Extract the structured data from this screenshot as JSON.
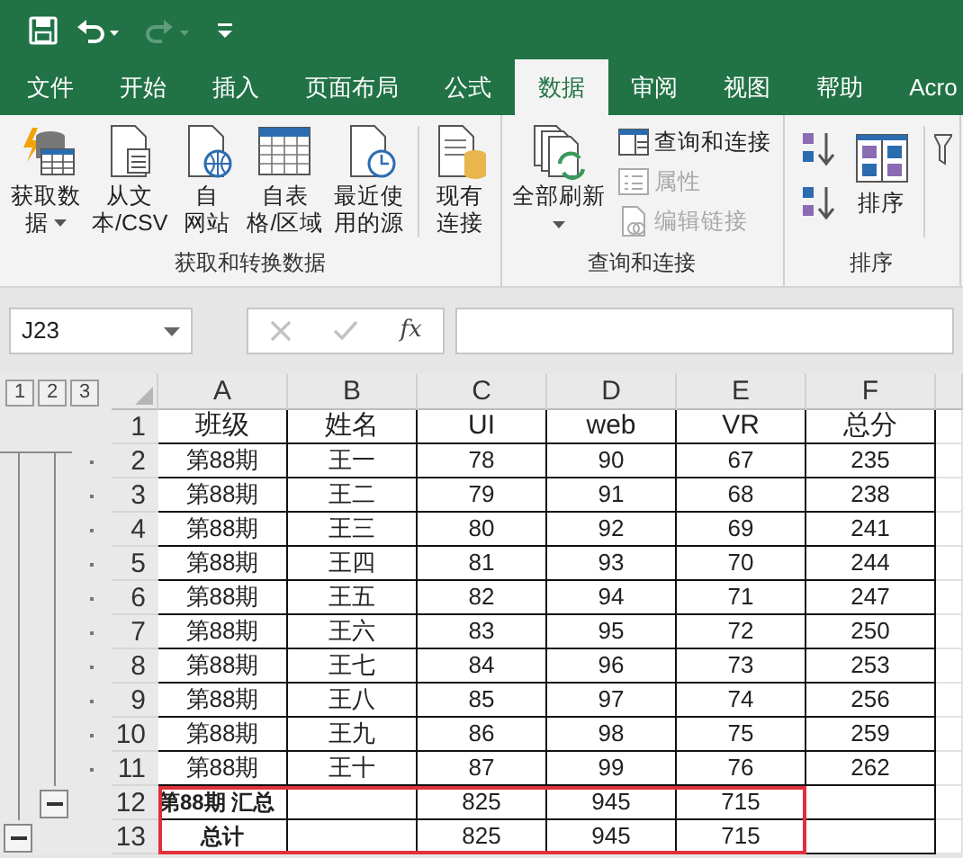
{
  "quick_access": [
    {
      "kind": "save",
      "disabled": false
    },
    {
      "kind": "undo",
      "disabled": false
    },
    {
      "kind": "redo",
      "disabled": true
    },
    {
      "kind": "customize",
      "disabled": false
    }
  ],
  "tabs": [
    {
      "label": "文件",
      "selected": false
    },
    {
      "label": "开始",
      "selected": false
    },
    {
      "label": "插入",
      "selected": false
    },
    {
      "label": "页面布局",
      "selected": false
    },
    {
      "label": "公式",
      "selected": false
    },
    {
      "label": "数据",
      "selected": true
    },
    {
      "label": "审阅",
      "selected": false
    },
    {
      "label": "视图",
      "selected": false
    },
    {
      "label": "帮助",
      "selected": false
    },
    {
      "label": "Acro",
      "selected": false
    }
  ],
  "ribbon_groups": [
    {
      "label": "获取和转换数据",
      "items": [
        {
          "kind": "large",
          "label_lines": [
            "获取数",
            "据"
          ],
          "dropdown": true,
          "disabled": false
        },
        {
          "kind": "large",
          "label_lines": [
            "从文",
            "本/CSV"
          ],
          "dropdown": false,
          "disabled": false
        },
        {
          "kind": "large",
          "label_lines": [
            "自",
            "网站"
          ],
          "dropdown": false,
          "disabled": false
        },
        {
          "kind": "large",
          "label_lines": [
            "自表",
            "格/区域"
          ],
          "dropdown": false,
          "disabled": false
        },
        {
          "kind": "large",
          "label_lines": [
            "最近使",
            "用的源"
          ],
          "dropdown": false,
          "disabled": false
        },
        {
          "kind": "separator"
        },
        {
          "kind": "large",
          "label_lines": [
            "现有",
            "连接"
          ],
          "dropdown": false,
          "disabled": false
        }
      ]
    },
    {
      "label": "查询和连接",
      "items": [
        {
          "kind": "large",
          "label_lines": [
            "全部刷新"
          ],
          "dropdown": true,
          "disabled": false
        },
        {
          "kind": "small_stack",
          "items": [
            {
              "label": "查询和连接",
              "disabled": false
            },
            {
              "label": "属性",
              "disabled": true
            },
            {
              "label": "编辑链接",
              "disabled": true
            }
          ]
        }
      ]
    },
    {
      "label": "排序",
      "items": [
        {
          "kind": "sort_icons"
        },
        {
          "kind": "large",
          "label_lines": [
            "排序"
          ],
          "dropdown": false,
          "disabled": false
        },
        {
          "kind": "separator"
        },
        {
          "kind": "cut_icon"
        }
      ]
    }
  ],
  "name_box": {
    "value": "J23"
  },
  "formula_buttons": [
    {
      "kind": "cancel",
      "disabled": true
    },
    {
      "kind": "enter",
      "disabled": true
    },
    {
      "kind": "function",
      "label": "fx",
      "disabled": false
    }
  ],
  "outline_levels": [
    {
      "label": "1"
    },
    {
      "label": "2"
    },
    {
      "label": "3"
    }
  ],
  "columns": [
    "A",
    "B",
    "C",
    "D",
    "E",
    "F"
  ],
  "rows": [
    {
      "number": "1",
      "kind": "header",
      "highlighted": false,
      "cells": [
        "班级",
        "姓名",
        "UI",
        "web",
        "VR",
        "总分"
      ]
    },
    {
      "number": "2",
      "kind": "detail",
      "highlighted": false,
      "cells": [
        "第88期",
        "王一",
        "78",
        "90",
        "67",
        "235"
      ]
    },
    {
      "number": "3",
      "kind": "detail",
      "highlighted": false,
      "cells": [
        "第88期",
        "王二",
        "79",
        "91",
        "68",
        "238"
      ]
    },
    {
      "number": "4",
      "kind": "detail",
      "highlighted": false,
      "cells": [
        "第88期",
        "王三",
        "80",
        "92",
        "69",
        "241"
      ]
    },
    {
      "number": "5",
      "kind": "detail",
      "highlighted": false,
      "cells": [
        "第88期",
        "王四",
        "81",
        "93",
        "70",
        "244"
      ]
    },
    {
      "number": "6",
      "kind": "detail",
      "highlighted": false,
      "cells": [
        "第88期",
        "王五",
        "82",
        "94",
        "71",
        "247"
      ]
    },
    {
      "number": "7",
      "kind": "detail",
      "highlighted": false,
      "cells": [
        "第88期",
        "王六",
        "83",
        "95",
        "72",
        "250"
      ]
    },
    {
      "number": "8",
      "kind": "detail",
      "highlighted": false,
      "cells": [
        "第88期",
        "王七",
        "84",
        "96",
        "73",
        "253"
      ]
    },
    {
      "number": "9",
      "kind": "detail",
      "highlighted": false,
      "cells": [
        "第88期",
        "王八",
        "85",
        "97",
        "74",
        "256"
      ]
    },
    {
      "number": "10",
      "kind": "detail",
      "highlighted": false,
      "cells": [
        "第88期",
        "王九",
        "86",
        "98",
        "75",
        "259"
      ]
    },
    {
      "number": "11",
      "kind": "detail",
      "highlighted": false,
      "cells": [
        "第88期",
        "王十",
        "87",
        "99",
        "76",
        "262"
      ]
    },
    {
      "number": "12",
      "kind": "subtotal",
      "highlighted": true,
      "cells": [
        "第88期 汇总",
        null,
        "825",
        "945",
        "715",
        null
      ]
    },
    {
      "number": "13",
      "kind": "total",
      "highlighted": true,
      "cells": [
        "总计",
        null,
        "825",
        "945",
        "715",
        null
      ]
    }
  ]
}
